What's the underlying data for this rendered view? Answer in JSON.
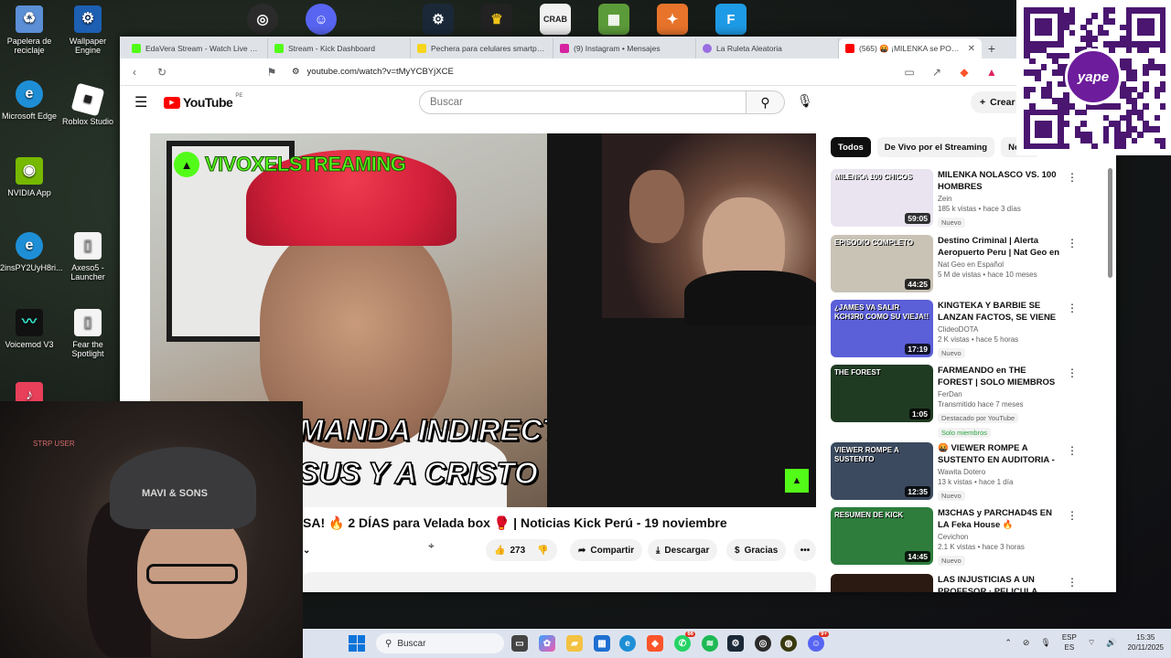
{
  "desktop": {
    "icons": [
      {
        "label": "Papelera de reciclaje",
        "icon": "recycle-bin-icon",
        "color": "#5b8fd6"
      },
      {
        "label": "Wallpaper Engine",
        "icon": "wallpaper-engine-icon",
        "color": "#1d5fb3"
      },
      {
        "label": "Microsoft Edge",
        "icon": "edge-icon",
        "color": "#1e8fd6"
      },
      {
        "label": "Roblox Studio",
        "icon": "roblox-icon",
        "color": "#2b2b2b"
      },
      {
        "label": "NVIDIA App",
        "icon": "nvidia-icon",
        "color": "#76b900"
      },
      {
        "label": "2insPY2UyH8ri...",
        "icon": "edge-icon",
        "color": "#1e8fd6"
      },
      {
        "label": "Axeso5 - Launcher",
        "icon": "file-icon",
        "color": "#f4f4f4"
      },
      {
        "label": "Voicemod V3",
        "icon": "voicemod-icon",
        "color": "#111111"
      },
      {
        "label": "Fear the Spotlight",
        "icon": "file-icon",
        "color": "#f4f4f4"
      }
    ]
  },
  "browser": {
    "tabs": [
      {
        "title": "EdaVera Stream - Watch Live on Ki...",
        "favicon_color": "#53fc18"
      },
      {
        "title": "Stream - Kick Dashboard",
        "favicon_color": "#53fc18"
      },
      {
        "title": "Pechera para celulares smartphone...",
        "favicon_color": "#f7d51d"
      },
      {
        "title": "(9) Instagram • Mensajes",
        "favicon_color": "#d6249f"
      },
      {
        "title": "La Ruleta Aleatoria",
        "favicon_color": "#9a6ee0"
      },
      {
        "title": "(565) 🤬 ¡MILENKA se PON...",
        "favicon_color": "#ff0000"
      }
    ],
    "url": "youtube.com/watch?v=tMyYCBYjXCE"
  },
  "youtube": {
    "logo_text": "YouTube",
    "region": "PE",
    "search_placeholder": "Buscar",
    "create_label": "Crear",
    "video": {
      "overlay_channel": "VIVOXELSTREAMING",
      "caption_line1": "MANDA INDIRECTA",
      "caption_line2": "SUS Y A CRISTO",
      "title": "SA! 🔥 2 DÍAS para Velada box 🥊 | Noticias Kick Perú - 19 noviembre",
      "likes": "273",
      "share_label": "Compartir",
      "download_label": "Descargar",
      "thanks_label": "Gracias"
    },
    "chips": [
      "Todos",
      "De Vivo por el Streaming",
      "Notici"
    ],
    "recommendations": [
      {
        "title": "MILENKA NOLASCO VS. 100 HOMBRES",
        "channel": "Zein",
        "stats": "185 k vistas • hace 3 días",
        "badge": "Nuevo",
        "duration": "59:05",
        "thumb_color": "#e9e4ef",
        "thumb_text": "MILENKA 100 CHICOS"
      },
      {
        "title": "Destino Criminal | Alerta Aeropuerto Peru | Nat Geo en ...",
        "channel": "Nat Geo en Español",
        "stats": "5 M de vistas • hace 10 meses",
        "badge": "",
        "duration": "44:25",
        "thumb_color": "#c9c3b6",
        "thumb_text": "EPISODIO COMPLETO"
      },
      {
        "title": "KINGTEKA Y BARBIE SE LANZAN FACTOS, SE VIENE ...",
        "channel": "ClideoDOTA",
        "stats": "2 K vistas • hace 5 horas",
        "badge": "Nuevo",
        "duration": "17:19",
        "thumb_color": "#5b5fd8",
        "thumb_text": "¿JAMES VA SALIR KCH3R0 COMO SU VIEJA!!"
      },
      {
        "title": "FARMEANDO en THE FOREST | SOLO MIEMBROS",
        "channel": "FerDan",
        "stats": "Transmitido hace 7 meses",
        "badge": "Destacado por YouTube",
        "members": "Solo miembros",
        "duration": "1:05",
        "thumb_color": "#1f3b22",
        "thumb_text": "THE FOREST"
      },
      {
        "title": "🤬 VIEWER ROMPE A SUSTENTO EN AUDITORIA - E...",
        "channel": "Wawita Dotero",
        "stats": "13 k vistas • hace 1 día",
        "badge": "Nuevo",
        "duration": "12:35",
        "thumb_color": "#3b4a5f",
        "thumb_text": "VIEWER ROMPE A SUSTENTO"
      },
      {
        "title": "M3CHAS y PARCHAD4S EN LA Feka House 🔥 ANTAURUS ...",
        "channel": "Cevichon",
        "stats": "2.1 K vistas • hace 3 horas",
        "badge": "Nuevo",
        "duration": "14:45",
        "thumb_color": "#2e7d3d",
        "thumb_text": "RESUMEN DE KICK"
      },
      {
        "title": "LAS INJUSTICIAS A UN PROFESOR · PELICULA",
        "channel": "",
        "stats": "",
        "badge": "",
        "duration": "",
        "thumb_color": "#2a1a12",
        "thumb_text": ""
      }
    ]
  },
  "overlays": {
    "qr_brand": "yape",
    "stream_user": "STRP USER",
    "hat_text": "MAVI & SONS"
  },
  "taskbar": {
    "search_placeholder": "Buscar",
    "badges": {
      "whatsapp": "66",
      "discord": "9+"
    },
    "lang_top": "ESP",
    "lang_bottom": "ES",
    "time": "15:35",
    "date": "20/11/2025"
  }
}
